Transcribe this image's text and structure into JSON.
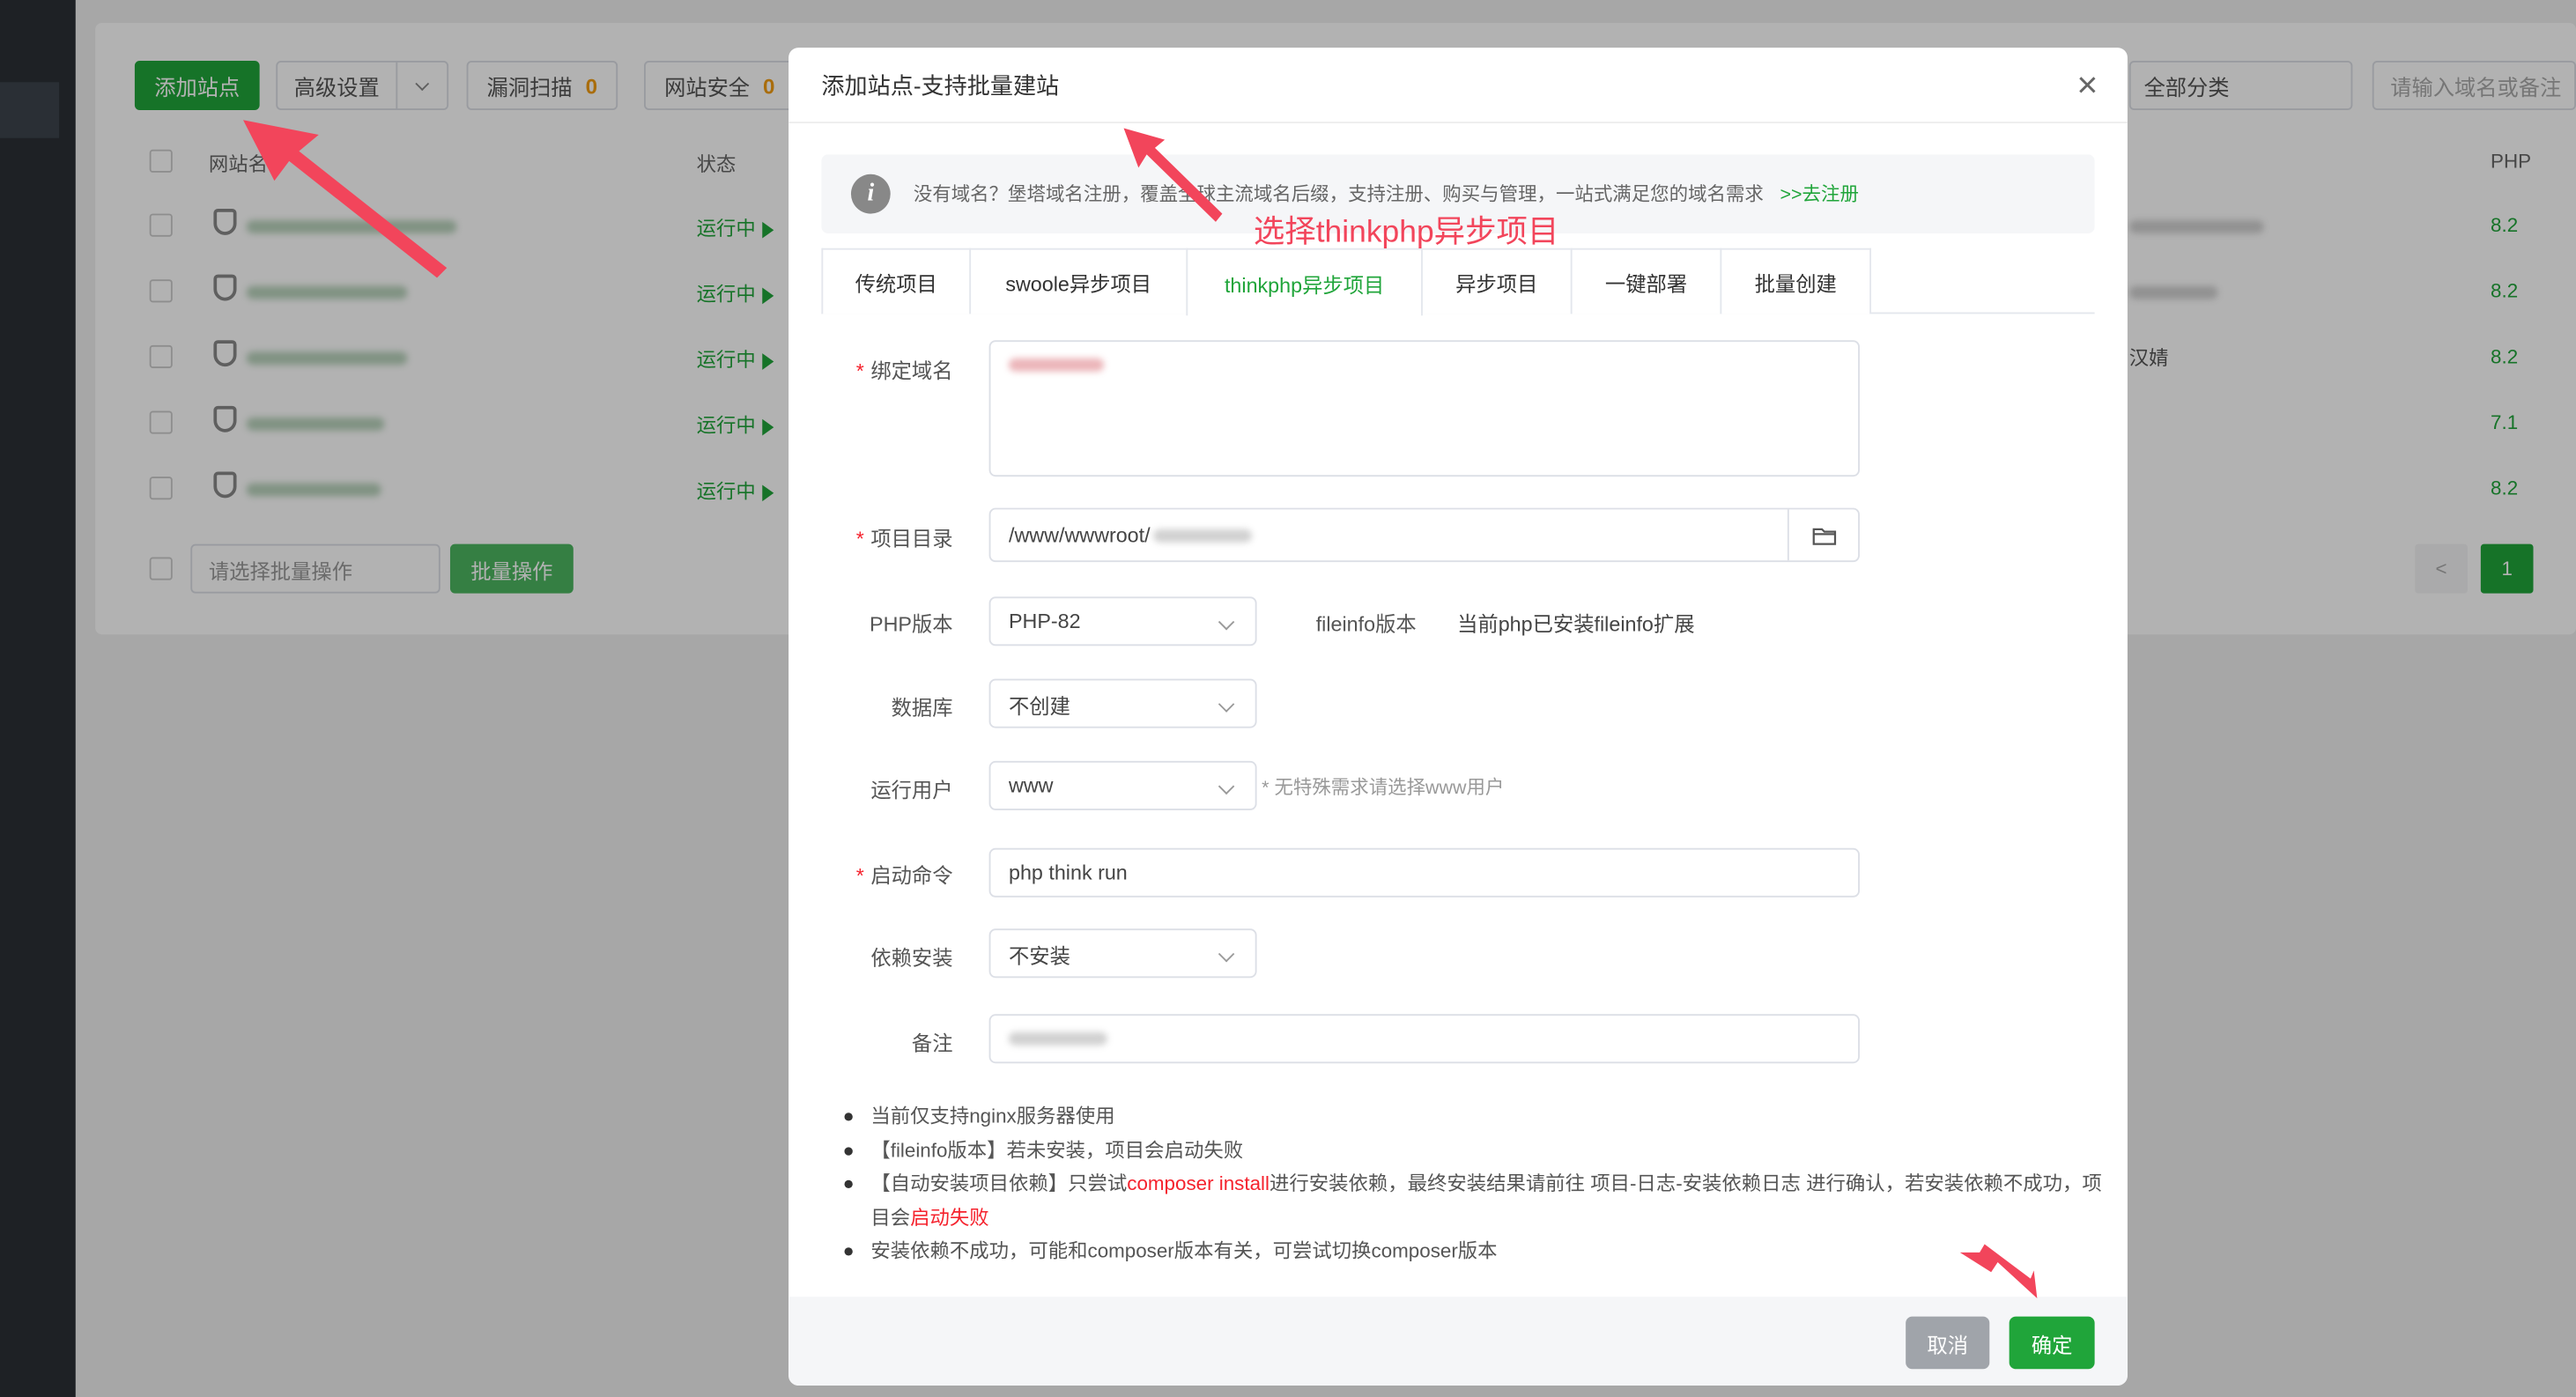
{
  "toolbar": {
    "add_site": "添加站点",
    "advanced": "高级设置",
    "vuln_scan": "漏洞扫描",
    "vuln_count": "0",
    "site_security": "网站安全",
    "security_count": "0",
    "category": "全部分类",
    "search_placeholder": "请输入域名或备注"
  },
  "table": {
    "headers": {
      "name": "网站名",
      "status": "状态",
      "php": "PHP"
    },
    "rows": [
      {
        "status": "运行中",
        "php": "8.2"
      },
      {
        "status": "运行中",
        "php": "8.2"
      },
      {
        "status": "运行中",
        "php": "8.2",
        "note": "汉婧"
      },
      {
        "status": "运行中",
        "php": "7.1"
      },
      {
        "status": "运行中",
        "php": "8.2"
      }
    ],
    "batch_placeholder": "请选择批量操作",
    "batch_button": "批量操作",
    "page": "1",
    "prev": "<"
  },
  "modal": {
    "title": "添加站点-支持批量建站",
    "close": "×",
    "notice": "没有域名？堡塔域名注册，覆盖全球主流域名后缀，支持注册、购买与管理，一站式满足您的域名需求",
    "notice_link": ">>去注册",
    "tabs": [
      "传统项目",
      "swoole异步项目",
      "thinkphp异步项目",
      "异步项目",
      "一键部署",
      "批量创建"
    ],
    "fields": {
      "domain_label": "绑定域名",
      "dir_label": "项目目录",
      "dir_value": "/www/wwwroot/",
      "php_label": "PHP版本",
      "php_value": "PHP-82",
      "fileinfo_label": "fileinfo版本",
      "fileinfo_value": "当前php已安装fileinfo扩展",
      "db_label": "数据库",
      "db_value": "不创建",
      "user_label": "运行用户",
      "user_value": "www",
      "user_hint": "* 无特殊需求请选择www用户",
      "cmd_label": "启动命令",
      "cmd_value": "php think run",
      "dep_label": "依赖安装",
      "dep_value": "不安装",
      "remark_label": "备注"
    },
    "notes": {
      "n1": "当前仅支持nginx服务器使用",
      "n2": "【fileinfo版本】若未安装，项目会启动失败",
      "n3a": "【自动安装项目依赖】只尝试",
      "n3b": "composer install",
      "n3c": "进行安装依赖，最终安装结果请前往 项目-日志-安装依赖日志 进行确认，若安装依赖不成功，项目会",
      "n3d": "启动失败",
      "n4": "安装依赖不成功，可能和composer版本有关，可尝试切换composer版本"
    },
    "cancel": "取消",
    "confirm": "确定"
  },
  "annotation": "选择thinkphp异步项目",
  "colors": {
    "brand_green": "#20a53a",
    "annotation_red": "#f2455b",
    "required_red": "#f5222d"
  }
}
